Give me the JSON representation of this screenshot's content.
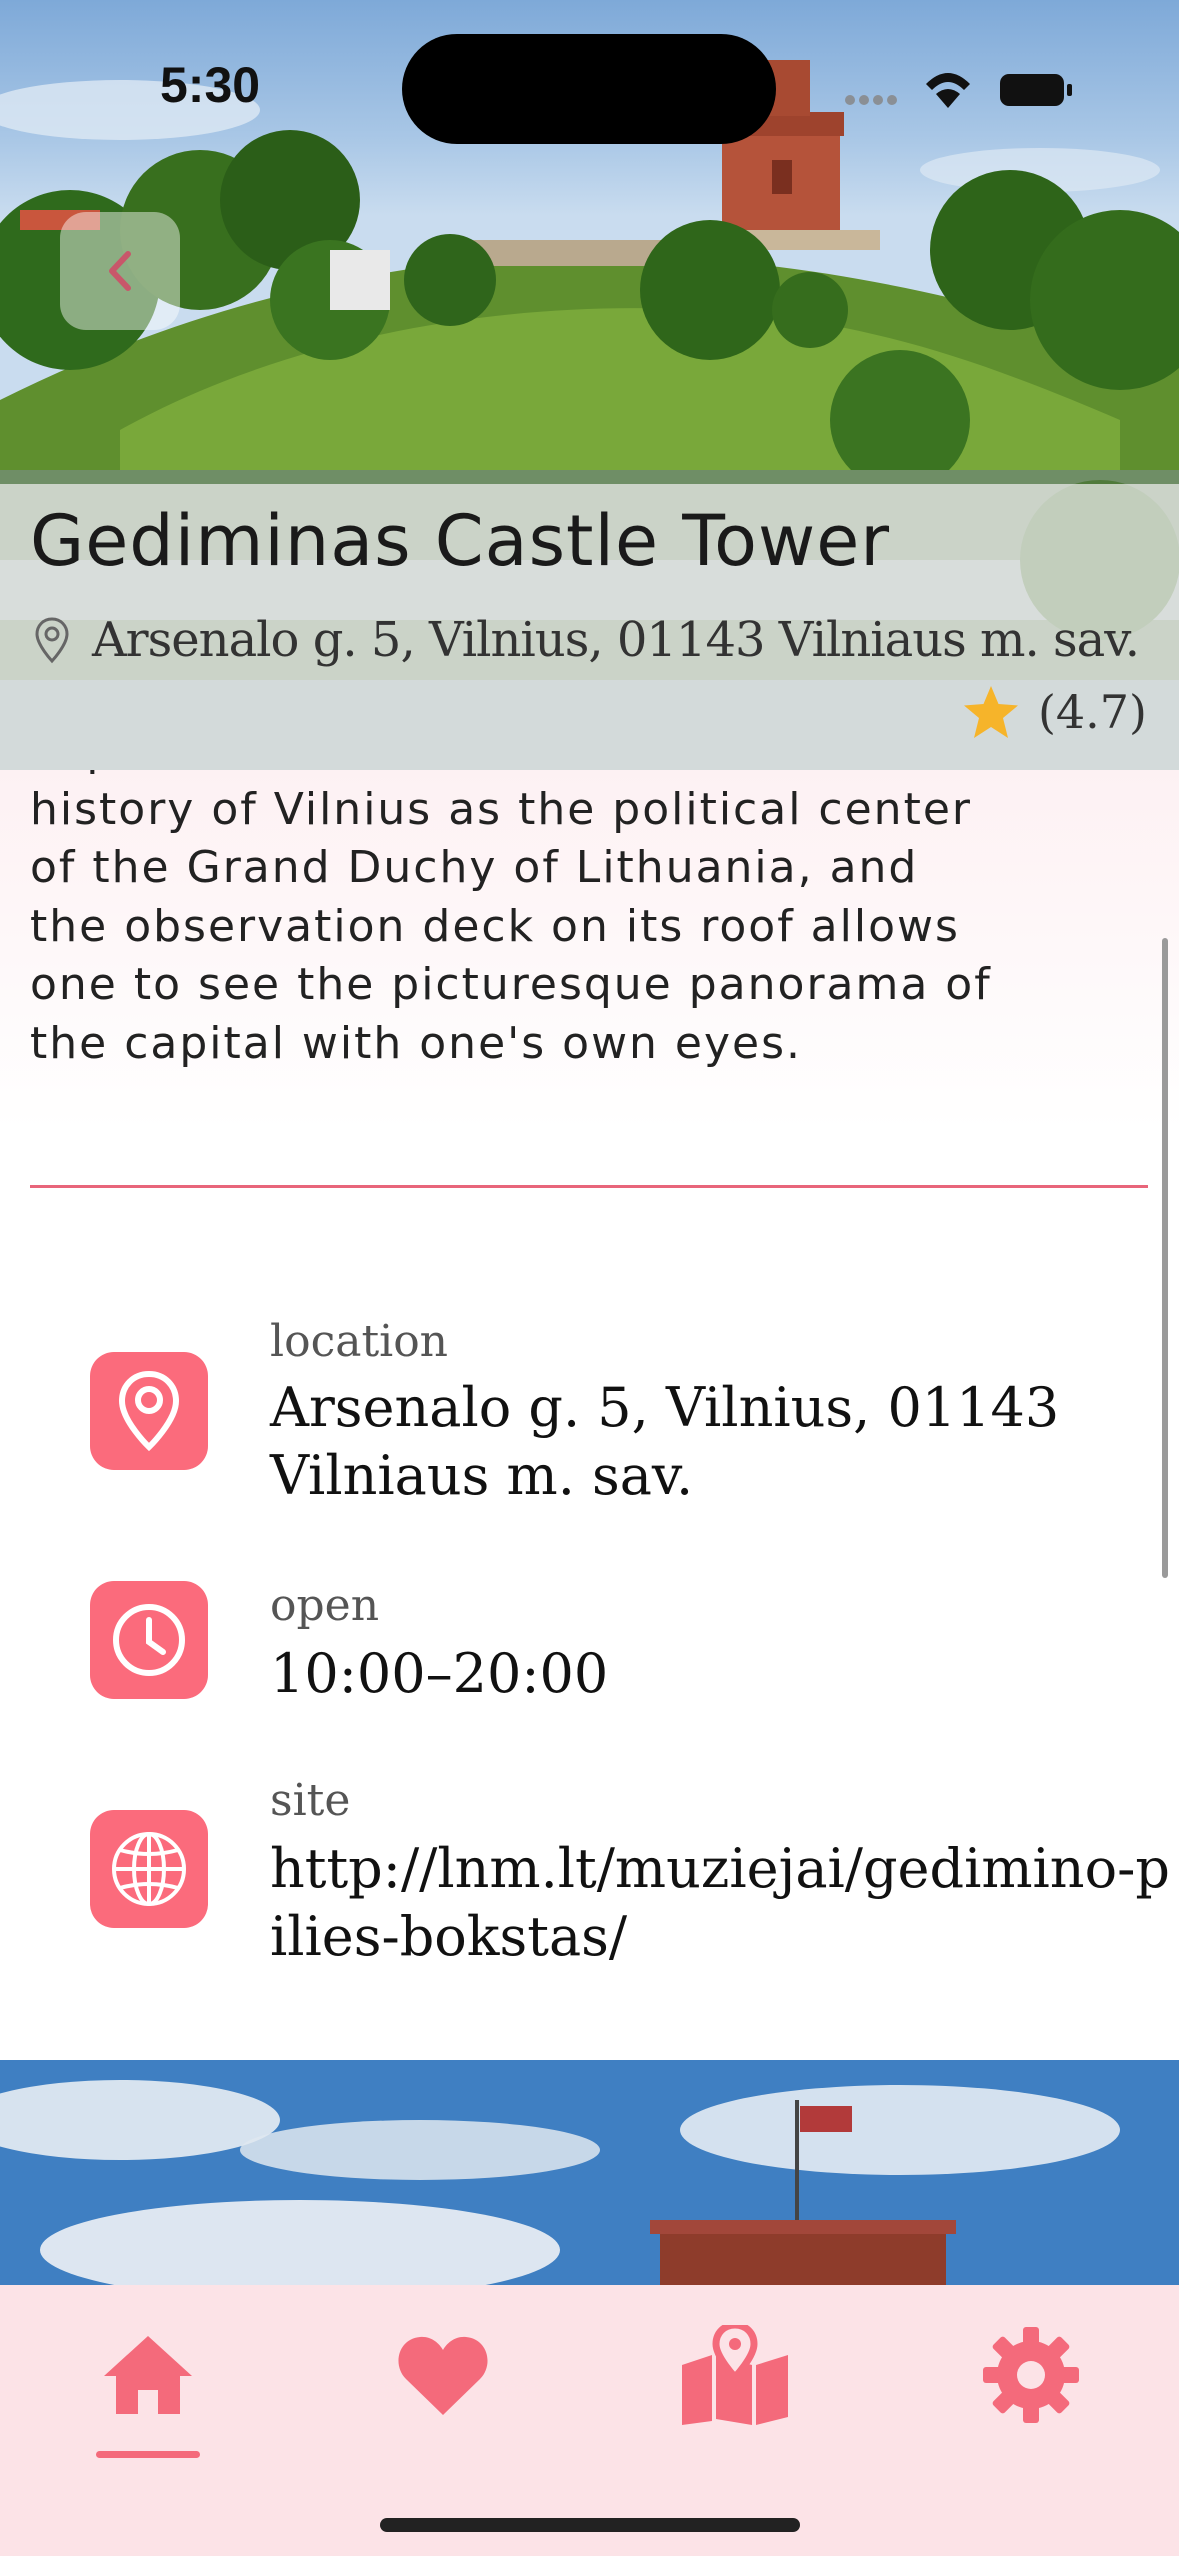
{
  "status_bar": {
    "time": "5:30"
  },
  "place": {
    "title": "Gediminas Castle Tower",
    "address": "Arsenalo g. 5, Vilnius, 01143 Vilniaus m. sav.",
    "rating_text": "(4.7)"
  },
  "description_lines": [
    "exposition introduces the visitor to the",
    "history of Vilnius as the political center",
    "of the Grand Duchy of Lithuania, and",
    "the observation deck on its roof allows",
    "one to see the picturesque panorama of",
    "the capital with one's own eyes."
  ],
  "info": {
    "location": {
      "label": "location",
      "value": "Arsenalo g. 5, Vilnius, 01143 Vilniaus m. sav."
    },
    "open": {
      "label": "open",
      "value": "10:00–20:00"
    },
    "site": {
      "label": "site",
      "value": "http://lnm.lt/muziejai/gedimino-pilies-bokstas/"
    }
  },
  "icons": {
    "back": "chevron-left-icon",
    "address": "map-pin-outline-icon",
    "rating": "star-icon",
    "location": "map-pin-icon",
    "open": "clock-icon",
    "site": "globe-icon"
  },
  "tabs": [
    {
      "icon": "home-icon",
      "active": true
    },
    {
      "icon": "heart-icon",
      "active": false
    },
    {
      "icon": "map-icon",
      "active": false
    },
    {
      "icon": "gear-icon",
      "active": false
    }
  ],
  "colors": {
    "accent": "#fb6b7c",
    "tab_bar_bg": "#fce3e7",
    "star": "#f6b42a"
  }
}
